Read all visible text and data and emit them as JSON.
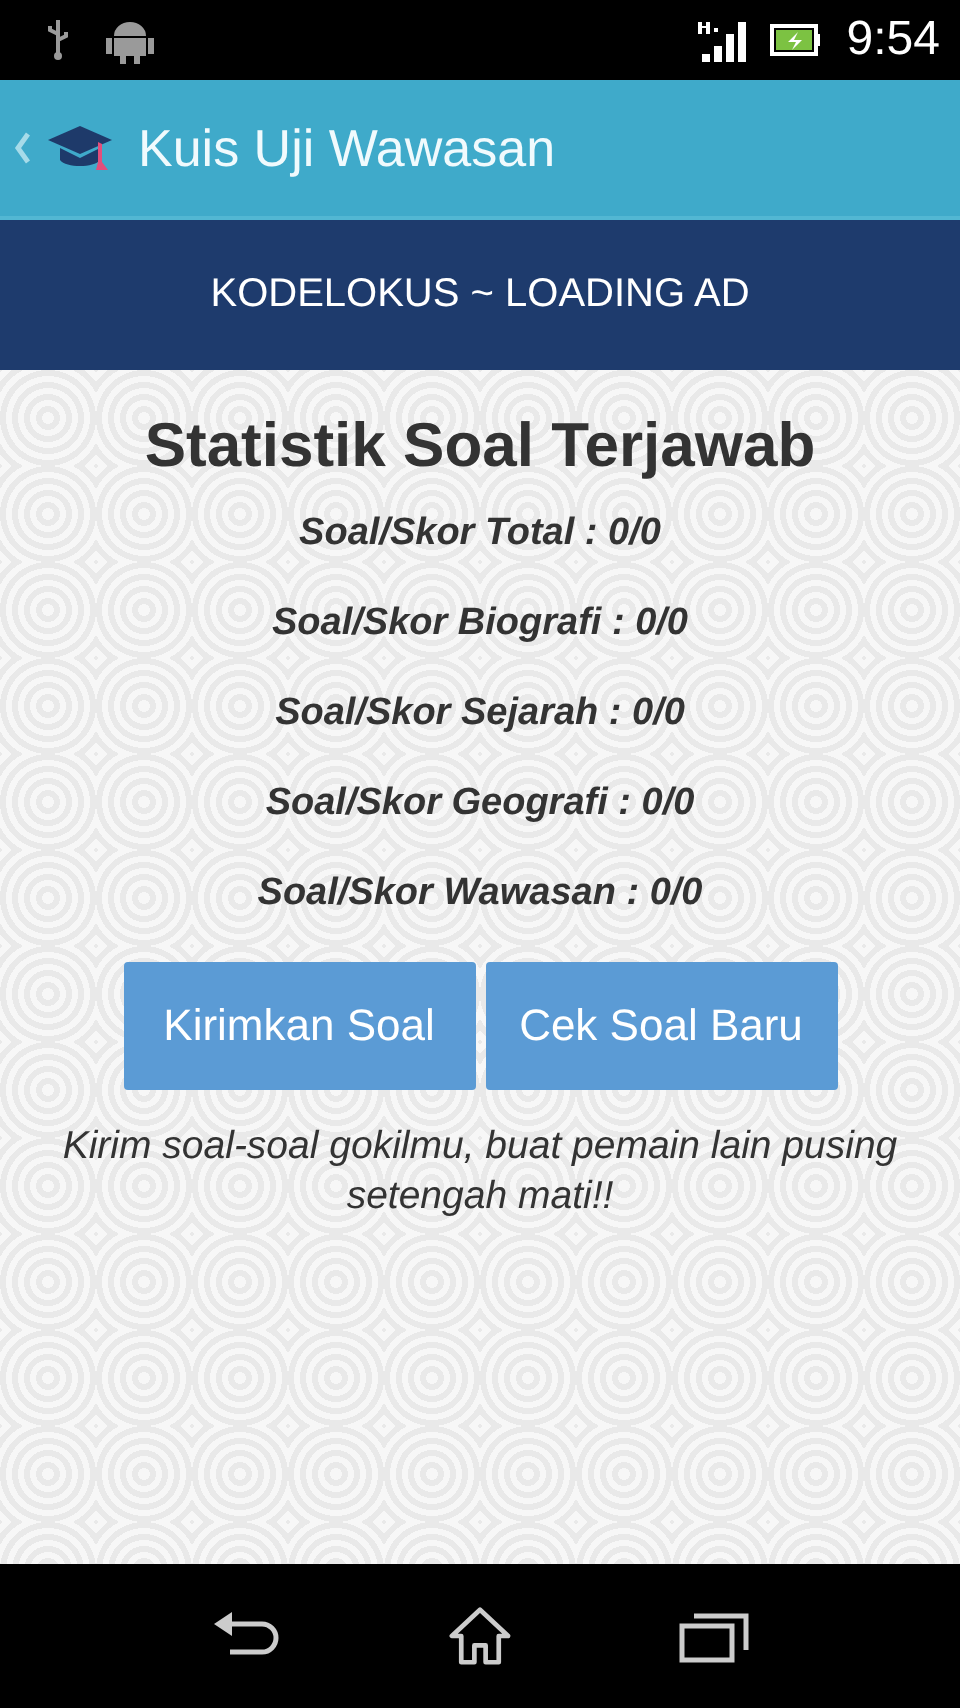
{
  "status_bar": {
    "time": "9:54"
  },
  "action_bar": {
    "title": "Kuis Uji Wawasan"
  },
  "ad_banner": {
    "text": "KODELOKUS ~ LOADING AD"
  },
  "stats": {
    "title": "Statistik Soal Terjawab",
    "rows": [
      "Soal/Skor Total : 0/0",
      "Soal/Skor Biografi : 0/0",
      "Soal/Skor Sejarah : 0/0",
      "Soal/Skor Geografi : 0/0",
      "Soal/Skor Wawasan : 0/0"
    ]
  },
  "buttons": [
    "Kirimkan Soal",
    "Cek Soal Baru"
  ],
  "note": "Kirim soal-soal gokilmu, buat pemain lain pusing setengah mati!!"
}
